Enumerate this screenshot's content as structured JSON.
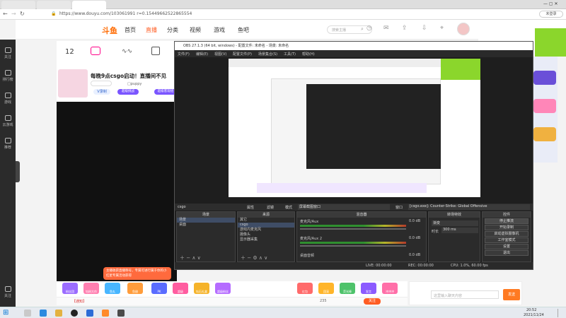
{
  "browser": {
    "tabs": [
      ""
    ],
    "url": "https://www.douyu.com/103061991  r=0.15449662522865554",
    "signin": "未登录"
  },
  "sidebar": {
    "items": [
      "关注",
      "排行榜",
      "游戏",
      "云游戏",
      "推荐",
      "关注"
    ]
  },
  "site": {
    "logo": "斗鱼",
    "nav": [
      "首页",
      "直播",
      "分类",
      "视频",
      "游戏",
      "鱼吧"
    ],
    "search_placeholder": "搜索主播"
  },
  "stream": {
    "level": "12",
    "title": "每晚9点csgo启动！直播间不见",
    "streamer": "□puppy",
    "tag": "V录制",
    "badges": [
      "超级挑战",
      "超级客观组"
    ]
  },
  "obs": {
    "title": "OBS 27.1.3 (64 bit, windows) - 配置文件: 未命名 - 场景: 未命名",
    "menu": [
      "文件(F)",
      "编辑(E)",
      "视图(V)",
      "配置文件(P)",
      "场景集合(S)",
      "工具(T)",
      "帮助(H)"
    ],
    "source_label": "csgo",
    "source_buttons": [
      "属性",
      "滤镜",
      "模式",
      "屏幕截图窗口",
      "窗口",
      "[csgo.exe]: Counter-Strike: Global Offensive"
    ],
    "scenes_header": "场景",
    "scenes": [
      "场景",
      "桌面"
    ],
    "sources_header": "来源",
    "sources": [
      "其它",
      "csgo",
      "游戏内麦克风",
      "摄像头",
      "显示器采集"
    ],
    "mixer_header": "混音器",
    "mixer": [
      {
        "name": "麦克风/Aux",
        "db": "0.0 dB"
      },
      {
        "name": "麦克风/Aux 2",
        "db": "0.0 dB"
      },
      {
        "name": "桌面音频",
        "db": "0.0 dB"
      }
    ],
    "transitions_header": "转场特效",
    "transition_type": "渐变",
    "duration_label": "时长",
    "duration": "300 ms",
    "controls_header": "控件",
    "controls": [
      "停止推流",
      "开始录制",
      "启动虚拟摄像机",
      "工作室模式",
      "设置",
      "退出"
    ],
    "status": {
      "live": "LIVE: 00:00:00",
      "rec": "REC: 00:00:00",
      "cpu": "CPU: 1.0%, 60.00 fps"
    }
  },
  "gifts": [
    "粉丝团",
    "钻粉大作",
    "鱼丸",
    "鱼翅",
    "PK",
    "超级",
    "钻石礼盒",
    "超级粉丝",
    "红包",
    "团宠",
    "荧光棒",
    "发言",
    "冲冲冲"
  ],
  "info": {
    "notice": "【通知】",
    "count": "235",
    "follow": "关注"
  },
  "toast": "主播收获直播称号，专属可进行属于你的小红星专属活动获得",
  "chat": {
    "placeholder": "这里输入聊天内容",
    "send": "发送"
  },
  "clock": {
    "time": "20:52",
    "date": "2021/11/24"
  },
  "colors": {
    "accent": "#ff5d23",
    "obs_bg": "#1e1e1e",
    "ad_green": "#8bd62c"
  }
}
